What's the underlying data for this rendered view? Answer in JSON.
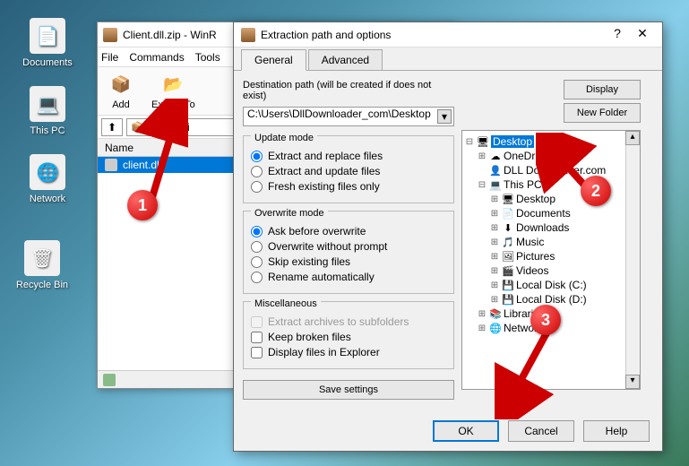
{
  "desktop": {
    "icons": [
      "Documents",
      "This PC",
      "Network",
      "Recycle Bin"
    ]
  },
  "winrar": {
    "title": "Client.dll.zip - WinR",
    "menus": [
      "File",
      "Commands",
      "Tools"
    ],
    "toolbar": [
      {
        "label": "Add"
      },
      {
        "label": "Extract To"
      }
    ],
    "pathfile": "ient.dll.zi",
    "list_header": "Name",
    "selected_file": "client.dll"
  },
  "dialog": {
    "title": "Extraction path and options",
    "tabs": [
      "General",
      "Advanced"
    ],
    "dest_label": "Destination path (will be created if does not exist)",
    "dest_value": "C:\\Users\\DllDownloader_com\\Desktop",
    "display_btn": "Display",
    "newfolder_btn": "New Folder",
    "update_mode": {
      "title": "Update mode",
      "options": [
        "Extract and replace files",
        "Extract and update files",
        "Fresh existing files only"
      ]
    },
    "overwrite_mode": {
      "title": "Overwrite mode",
      "options": [
        "Ask before overwrite",
        "Overwrite without prompt",
        "Skip existing files",
        "Rename automatically"
      ]
    },
    "misc": {
      "title": "Miscellaneous",
      "options": [
        "Extract archives to subfolders",
        "Keep broken files",
        "Display files in Explorer"
      ]
    },
    "save_settings": "Save settings",
    "tree": [
      {
        "label": "Desktop",
        "indent": 0,
        "expander": "⊟",
        "icon": "🖥",
        "selected": true
      },
      {
        "label": "OneDrive",
        "indent": 1,
        "expander": "⊞",
        "icon": "☁"
      },
      {
        "label": "DLL Downloader.com",
        "indent": 1,
        "expander": "",
        "icon": "👤"
      },
      {
        "label": "This PC",
        "indent": 1,
        "expander": "⊟",
        "icon": "💻"
      },
      {
        "label": "Desktop",
        "indent": 2,
        "expander": "⊞",
        "icon": "🖥"
      },
      {
        "label": "Documents",
        "indent": 2,
        "expander": "⊞",
        "icon": "📄"
      },
      {
        "label": "Downloads",
        "indent": 2,
        "expander": "⊞",
        "icon": "⬇"
      },
      {
        "label": "Music",
        "indent": 2,
        "expander": "⊞",
        "icon": "🎵"
      },
      {
        "label": "Pictures",
        "indent": 2,
        "expander": "⊞",
        "icon": "🖼"
      },
      {
        "label": "Videos",
        "indent": 2,
        "expander": "⊞",
        "icon": "🎬"
      },
      {
        "label": "Local Disk (C:)",
        "indent": 2,
        "expander": "⊞",
        "icon": "💾"
      },
      {
        "label": "Local Disk (D:)",
        "indent": 2,
        "expander": "⊞",
        "icon": "💾"
      },
      {
        "label": "Libraries",
        "indent": 1,
        "expander": "⊞",
        "icon": "📚"
      },
      {
        "label": "Network",
        "indent": 1,
        "expander": "⊞",
        "icon": "🌐"
      }
    ],
    "buttons": {
      "ok": "OK",
      "cancel": "Cancel",
      "help": "Help"
    },
    "help_icon": "?",
    "close_icon": "✕"
  },
  "annotations": {
    "b1": "1",
    "b2": "2",
    "b3": "3"
  }
}
